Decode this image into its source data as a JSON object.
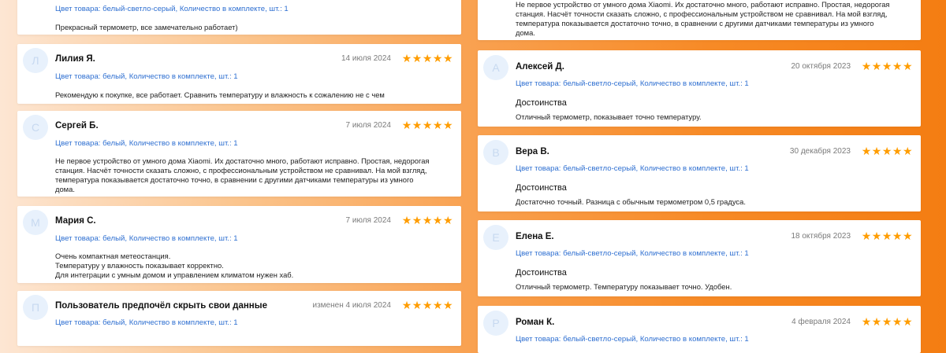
{
  "star_color": "#ff9d00",
  "link_color": "#2e6fd1",
  "rating_icon": "star-icon",
  "left_reviews": [
    {
      "meta": "Цвет товара: белый-светло-серый, Количество в комплекте, шт.: 1",
      "text": "Прекрасный термометр, все замечательно работает)"
    },
    {
      "avatar": "Л",
      "name": "Лилия Я.",
      "date": "14 июля 2024",
      "rating": 5,
      "meta": "Цвет товара: белый, Количество в комплекте, шт.: 1",
      "text": "Рекомендую к покупке, все работает. Сравнить температуру и влажность к сожалению не с чем"
    },
    {
      "avatar": "С",
      "name": "Сергей Б.",
      "date": "7 июля 2024",
      "rating": 5,
      "meta": "Цвет товара: белый, Количество в комплекте, шт.: 1",
      "text_lines": [
        "Не первое устройство от умного дома Xiaomi. Их достаточно много, работают исправно. Простая, недорогая",
        "станция. Насчёт точности сказать сложно, с профессиональным устройством не сравнивал. На мой взгляд,",
        "температура показывается достаточно точно, в сравнении с другими датчиками температуры из умного",
        "дома."
      ]
    },
    {
      "avatar": "М",
      "name": "Мария С.",
      "date": "7 июля 2024",
      "rating": 5,
      "meta": "Цвет товара: белый, Количество в комплекте, шт.: 1",
      "text_lines": [
        "Очень компактная метеостанция.",
        "Температуру у влажность показывает корректно.",
        "Для интеграции с умным домом и управлением климатом нужен хаб."
      ]
    },
    {
      "avatar": "П",
      "name": "Пользователь предпочёл скрыть свои данные",
      "date": "изменен 4 июля 2024",
      "rating": 5,
      "meta": "Цвет товара: белый, Количество в комплекте, шт.: 1"
    }
  ],
  "right_reviews": [
    {
      "text_lines": [
        "Не первое устройство от умного дома Xiaomi. Их достаточно много, работают исправно. Простая, недорогая",
        "станция. Насчёт точности сказать сложно, с профессиональным устройством не сравнивал. На мой взгляд,",
        "температура показывается достаточно точно, в сравнении с другими датчиками температуры из умного",
        "дома."
      ]
    },
    {
      "avatar": "А",
      "name": "Алексей Д.",
      "date": "20 октября 2023",
      "rating": 5,
      "meta": "Цвет товара: белый-светло-серый, Количество в комплекте, шт.: 1",
      "section": "Достоинства",
      "text": "Отличный термометр, показывает точно температуру."
    },
    {
      "avatar": "В",
      "name": "Вера В.",
      "date": "30 декабря 2023",
      "rating": 5,
      "meta": "Цвет товара: белый-светло-серый, Количество в комплекте, шт.: 1",
      "section": "Достоинства",
      "text": "Достаточно точный. Разница с обычным термометром 0,5 градуса."
    },
    {
      "avatar": "Е",
      "name": "Елена Е.",
      "date": "18 октября 2023",
      "rating": 5,
      "meta": "Цвет товара: белый-светло-серый, Количество в комплекте, шт.: 1",
      "section": "Достоинства",
      "text": "Отличный термометр. Температуру показывает точно. Удобен."
    },
    {
      "avatar": "Р",
      "name": "Роман К.",
      "date": "4 февраля 2024",
      "rating": 5,
      "meta": "Цвет товара: белый-светло-серый, Количество в комплекте, шт.: 1"
    }
  ]
}
